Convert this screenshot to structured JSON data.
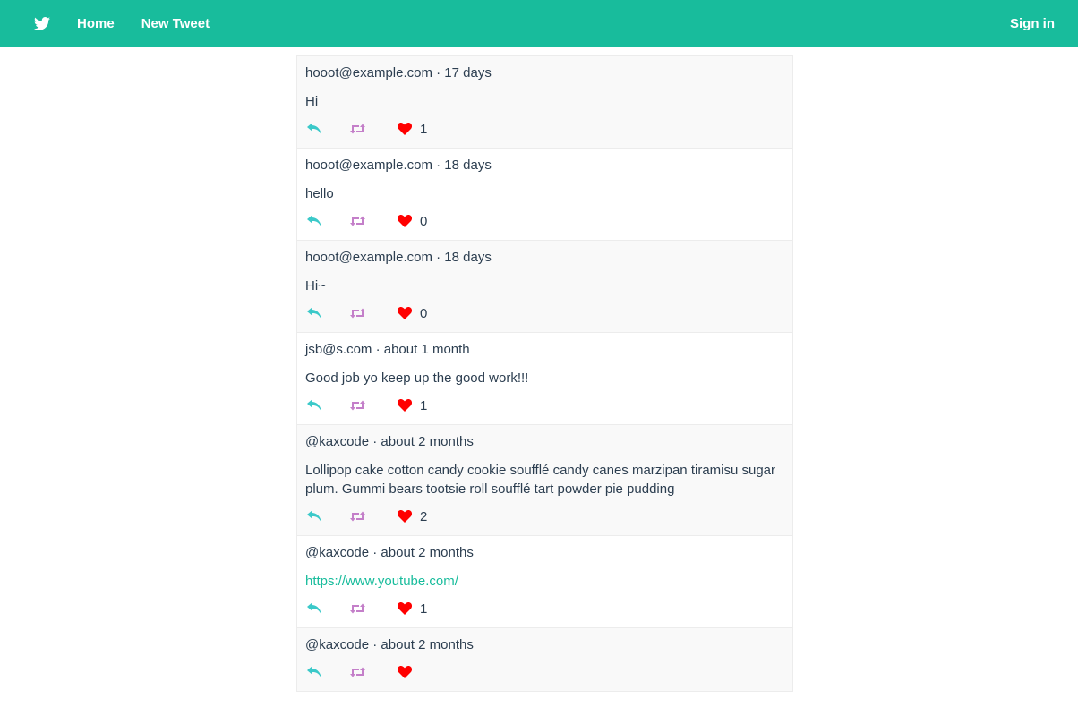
{
  "nav": {
    "home_label": "Home",
    "new_tweet_label": "New Tweet",
    "sign_in_label": "Sign in"
  },
  "colors": {
    "navbar": "#18bc9c",
    "reply_icon": "#3bc9c9",
    "retweet_icon": "#c47fc9",
    "like_icon": "#ff0000",
    "link": "#18bc9c"
  },
  "tweets": [
    {
      "author": "hooot@example.com",
      "time": "17 days",
      "meta": "hooot@example.com · 17 days",
      "body": "Hi",
      "likes": "1",
      "is_link": false
    },
    {
      "author": "hooot@example.com",
      "time": "18 days",
      "meta": "hooot@example.com · 18 days",
      "body": "hello",
      "likes": "0",
      "is_link": false
    },
    {
      "author": "hooot@example.com",
      "time": "18 days",
      "meta": "hooot@example.com · 18 days",
      "body": "Hi~",
      "likes": "0",
      "is_link": false
    },
    {
      "author": "jsb@s.com",
      "time": "about 1 month",
      "meta": "jsb@s.com · about 1 month",
      "body": "Good job yo keep up the good work!!!",
      "likes": "1",
      "is_link": false
    },
    {
      "author": "@kaxcode",
      "time": "about 2 months",
      "meta": "@kaxcode · about 2 months",
      "body": "Lollipop cake cotton candy cookie soufflé candy canes marzipan tiramisu sugar plum. Gummi bears tootsie roll soufflé tart powder pie pudding",
      "likes": "2",
      "is_link": false
    },
    {
      "author": "@kaxcode",
      "time": "about 2 months",
      "meta": "@kaxcode · about 2 months",
      "body": "https://www.youtube.com/",
      "likes": "1",
      "is_link": true
    },
    {
      "author": "@kaxcode",
      "time": "about 2 months",
      "meta": "@kaxcode · about 2 months",
      "body": "",
      "likes": "",
      "is_link": false
    }
  ]
}
